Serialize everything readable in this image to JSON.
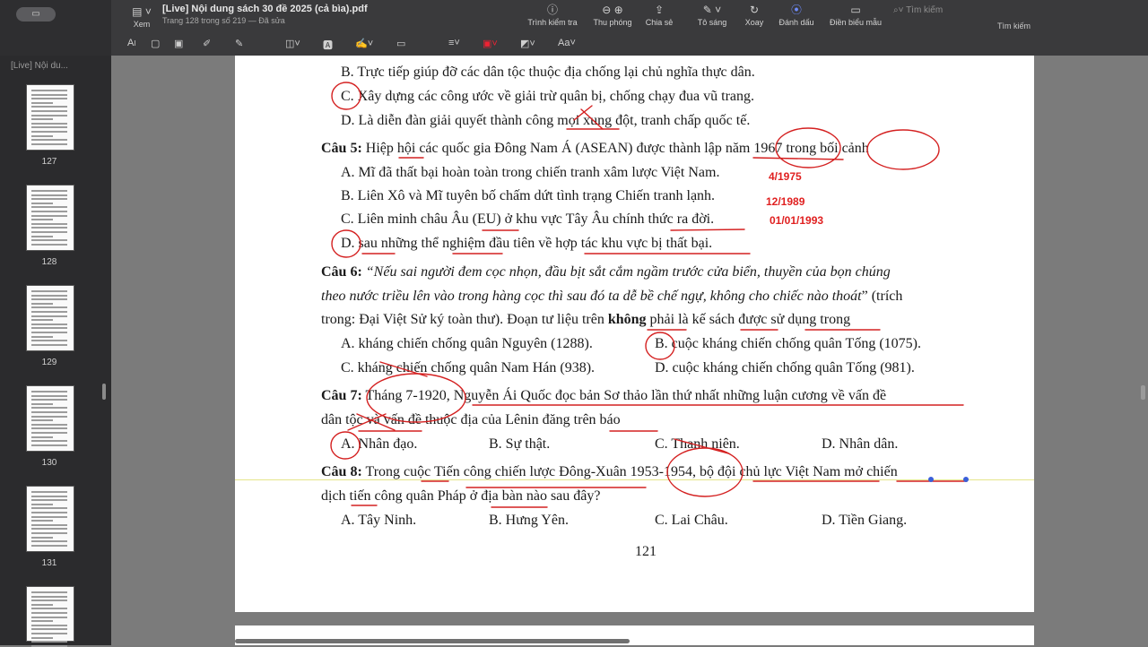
{
  "window": {
    "title": "[Live] Nội dung sách 30 đề 2025 (cả bìa).pdf",
    "subtitle": "Trang 128 trong số 219 — Đã sửa",
    "view_label": "Xem"
  },
  "toolbar": {
    "tools": [
      {
        "label": "Trình kiểm tra",
        "icon": "info-icon"
      },
      {
        "label": "Thu phóng",
        "icon": "zoom-icon"
      },
      {
        "label": "Chia sẻ",
        "icon": "share-icon"
      },
      {
        "label": "Tô sáng",
        "icon": "highlight-icon"
      },
      {
        "label": "Xoay",
        "icon": "rotate-icon"
      },
      {
        "label": "Đánh dấu",
        "icon": "markup-icon"
      },
      {
        "label": "Điền biểu mẫu",
        "icon": "form-icon"
      }
    ],
    "search_placeholder": "Tìm kiếm",
    "search_caption": "Tìm kiếm"
  },
  "sidebar": {
    "label": "[Live] Nội du...",
    "thumbs": [
      "127",
      "128",
      "129",
      "130",
      "131"
    ]
  },
  "page": {
    "number": "121",
    "lines": {
      "q4b": "B. Trực tiếp giúp đỡ các dân tộc thuộc địa chống lại chủ nghĩa thực dân.",
      "q4c": "C. Xây dựng các công ước về giải trừ quân bị, chống chạy đua vũ trang.",
      "q4d": "D. Là diễn đàn giải quyết thành công mọi xung đột, tranh chấp quốc tế.",
      "q5_label": "Câu 5:",
      "q5": " Hiệp hội các quốc gia Đông Nam Á (ASEAN) được thành lập năm 1967 trong bối cảnh",
      "q5a": "A. Mĩ đã thất bại hoàn toàn trong chiến tranh xâm lược Việt Nam.",
      "q5b": "B. Liên Xô và Mĩ tuyên bố chấm dứt tình trạng Chiến tranh lạnh.",
      "q5c": "C. Liên minh châu Âu (EU) ở khu vực Tây Âu chính thức ra đời.",
      "q5d": "D. sau những thể nghiệm đầu tiên về hợp tác khu vực bị thất bại.",
      "q6_label": "Câu 6:",
      "q6_l1": " “Nếu sai người đem cọc nhọn, đầu bịt sắt cắm ngầm trước cửa biển, thuyền của bọn chúng",
      "q6_l2": "theo nước triều lên vào trong hàng cọc thì sau đó ta dễ bề chế ngự, không cho chiếc nào thoát",
      "q6_l2b": "” (trích",
      "q6_l3a": "trong: Đại Việt Sử ký toàn thư). Đoạn tư liệu trên ",
      "q6_l3b": "không",
      "q6_l3c": " phải là kế sách được sử dụng trong",
      "q6a": "A. kháng chiến chống quân Nguyên (1288).",
      "q6b": "B. cuộc kháng chiến chống quân Tống (1075).",
      "q6c": "C. kháng chiến chống quân Nam Hán (938).",
      "q6d": "D. cuộc kháng chiến chống quân Tống (981).",
      "q7_label": "Câu 7:",
      "q7_l1": " Tháng 7-1920, Nguyễn Ái Quốc đọc bản Sơ thảo lần thứ nhất những luận cương về vấn đề",
      "q7_l2": "dân tộc và vấn đề thuộc địa của Lênin đăng trên báo",
      "q7a": "A. Nhân đạo.",
      "q7b": "B. Sự thật.",
      "q7c": "C. Thanh niên.",
      "q7d": "D. Nhân dân.",
      "q8_label": "Câu 8:",
      "q8_l1": " Trong cuộc Tiến công chiến lược Đông-Xuân 1953-1954, bộ đội chủ lực Việt Nam mở chiến",
      "q8_l2": "dịch tiến công quân Pháp ở địa bàn nào sau đây?",
      "q8a": "A. Tây Ninh.",
      "q8b": "B. Hưng Yên.",
      "q8c": "C. Lai Châu.",
      "q8d": "D. Tiền Giang."
    },
    "annotations": {
      "a1": "4/1975",
      "a2": "12/1989",
      "a3": "01/01/1993"
    }
  }
}
